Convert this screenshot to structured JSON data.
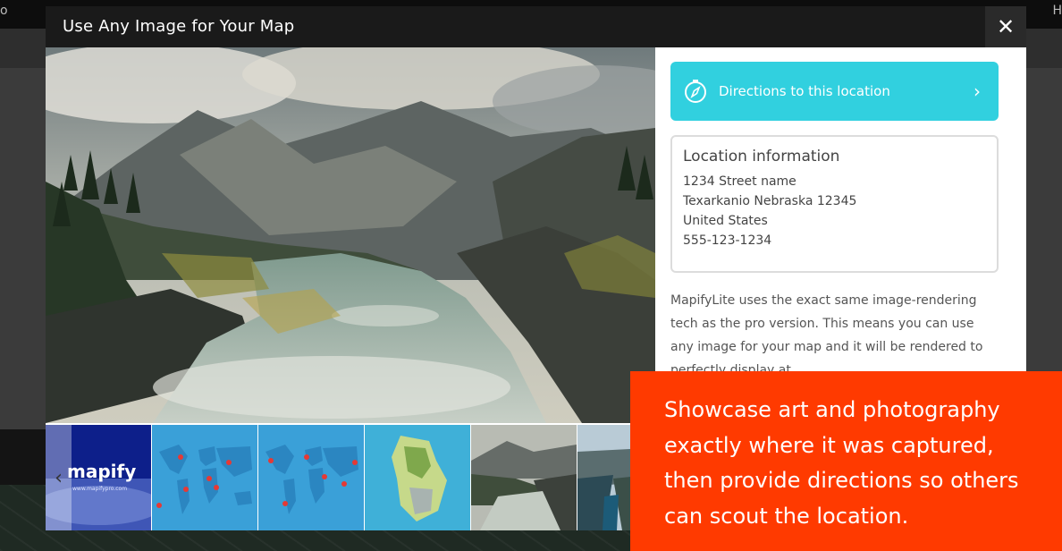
{
  "modal": {
    "title": "Use Any Image for Your Map",
    "close_glyph": "✕"
  },
  "background": {
    "left_fragment": "o",
    "right_fragment": "H"
  },
  "gallery": {
    "prev_glyph": "‹",
    "thumbnails": [
      {
        "name": "mapify-logo",
        "logo_text": "mapify",
        "caption": "www.mapifypro.com"
      },
      {
        "name": "world-map-1"
      },
      {
        "name": "world-map-2"
      },
      {
        "name": "island-map"
      },
      {
        "name": "river-landscape"
      },
      {
        "name": "canyon-landscape"
      }
    ]
  },
  "sidebar": {
    "directions_button": {
      "label": "Directions to this location",
      "icon": "compass-icon",
      "chevron": "›"
    },
    "location_info": {
      "title": "Location information",
      "street": "1234 Street name",
      "city_line": "Texarkanio Nebraska 12345",
      "country": "United States",
      "phone": "555-123-1234"
    },
    "description": "MapifyLite uses the exact same image-rendering tech as the pro version. This means you can use any image for your map and it will be rendered to perfectly display at"
  },
  "callout": {
    "text": "Showcase art and photography exactly where it was captured, then provide directions so others can scout the location."
  },
  "colors": {
    "accent": "#31d0df",
    "callout": "#ff3a00",
    "header": "#1a1a1a"
  }
}
